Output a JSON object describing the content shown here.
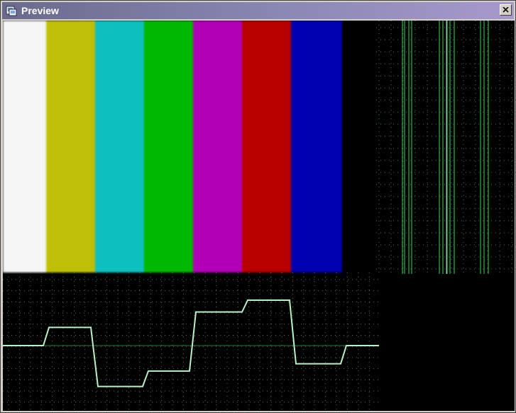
{
  "window": {
    "title": "Preview"
  },
  "icons": {
    "app": "preview-app-icon",
    "close": "close-icon"
  },
  "colors": {
    "titlebar_start": "#6a6a8e",
    "titlebar_end": "#a898cc",
    "trace": "#b8f0c8",
    "grid": "#4a7a58",
    "parade_trace": "#2fd45a"
  },
  "color_bars": [
    {
      "name": "white",
      "color": "#f6f6f6"
    },
    {
      "name": "yellow",
      "color": "#bfbf0a"
    },
    {
      "name": "cyan",
      "color": "#0ebfbf"
    },
    {
      "name": "green",
      "color": "#00b800"
    },
    {
      "name": "magenta",
      "color": "#b200b6"
    },
    {
      "name": "red",
      "color": "#b80000"
    },
    {
      "name": "blue",
      "color": "#0000b0"
    }
  ],
  "waveform_levels": [
    0.5,
    0.7,
    0.5,
    0.05,
    0.05,
    0.22,
    0.87,
    1.0,
    0.5,
    0.3,
    0.5
  ]
}
